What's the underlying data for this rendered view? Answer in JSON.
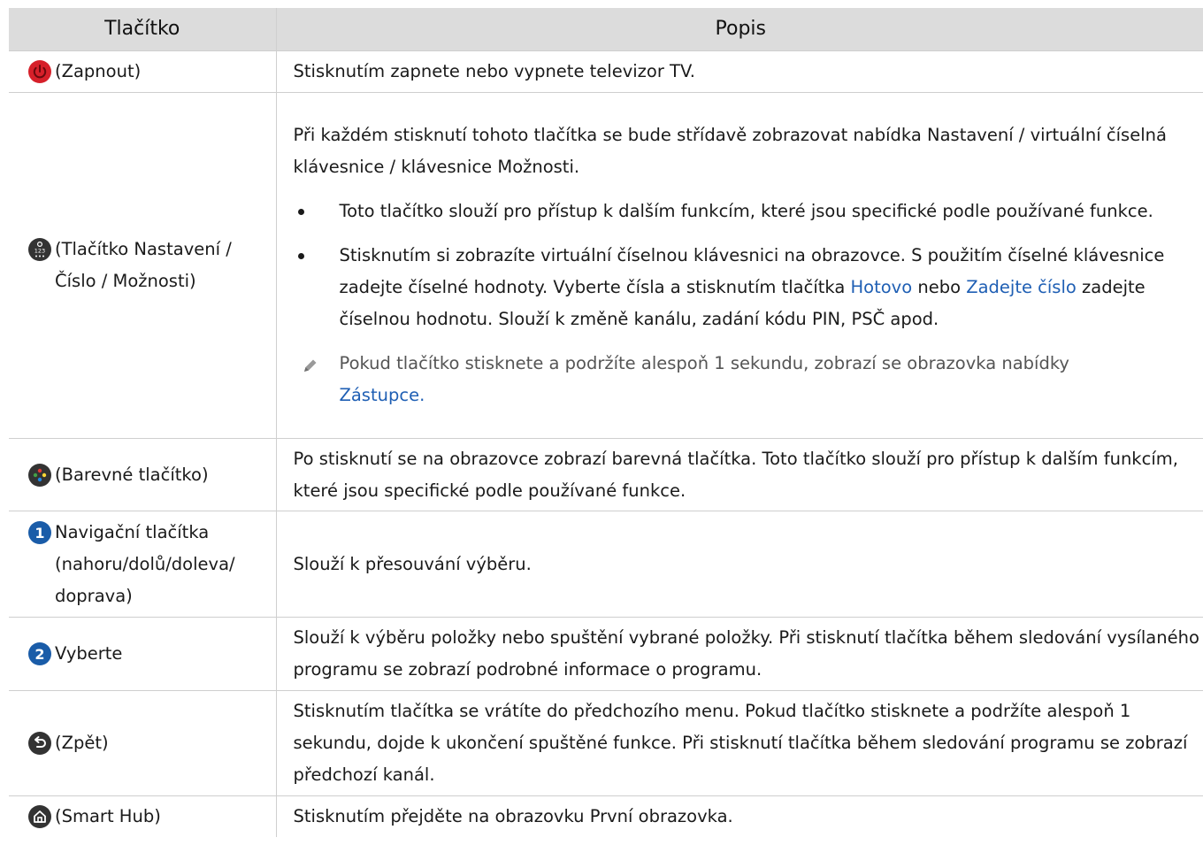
{
  "table": {
    "headers": [
      "Tlačítko",
      "Popis"
    ],
    "rows": {
      "power": {
        "button_label": "(Zapnout)",
        "icon": "power-icon",
        "desc": "Stisknutím zapnete nebo vypnete televizor TV."
      },
      "settings": {
        "button_label": "(Tlačítko Nastavení / Číslo / Možnosti)",
        "icon": "settings-number-icon",
        "desc_intro": "Při každém stisknutí tohoto tlačítka se bude střídavě zobrazovat nabídka Nastavení / virtuální číselná klávesnice / klávesnice Možnosti.",
        "bullet1": "Toto tlačítko slouží pro přístup k dalším funkcím, které jsou specifické podle používané funkce.",
        "bullet2_part1": "Stisknutím si zobrazíte virtuální číselnou klávesnici na obrazovce. S použitím číselné klávesnice zadejte číselné hodnoty. Vyberte čísla a stisknutím tlačítka",
        "bullet2_link1": "Hotovo",
        "bullet2_mid": "nebo",
        "bullet2_link2": "Zadejte číslo",
        "bullet2_part2": "zadejte číselnou hodnotu. Slouží k změně kanálu, zadání kódu PIN, PSČ apod.",
        "note_text": "Pokud tlačítko stisknete a podržíte alespoň 1 sekundu, zobrazí se obrazovka nabídky",
        "note_link": "Zástupce",
        "note_end": "."
      },
      "color": {
        "button_label": "(Barevné tlačítko)",
        "icon": "color-button-icon",
        "desc": "Po stisknutí se na obrazovce zobrazí barevná tlačítka. Toto tlačítko slouží pro přístup k dalším funkcím, které jsou specifické podle používané funkce."
      },
      "nav": {
        "badge": "1",
        "button_label": "Navigační tlačítka (nahoru/dolů/doleva/ doprava)",
        "desc": "Slouží k přesouvání výběru."
      },
      "select": {
        "badge": "2",
        "button_label": "Vyberte",
        "desc": "Slouží k výběru položky nebo spuštění vybrané položky. Při stisknutí tlačítka během sledování vysílaného programu se zobrazí podrobné informace o programu."
      },
      "back": {
        "button_label": "(Zpět)",
        "icon": "back-icon",
        "desc": "Stisknutím tlačítka se vrátíte do předchozího menu. Pokud tlačítko stisknete a podržíte alespoň 1 sekundu, dojde k ukončení spuštěné funkce. Při stisknutí tlačítka během sledování programu se zobrazí předchozí kanál."
      },
      "smarthub": {
        "button_label": "(Smart Hub)",
        "icon": "home-icon",
        "desc": "Stisknutím přejděte na obrazovku První obrazovka."
      }
    }
  },
  "colors": {
    "header_bg": "#dcdcdc",
    "link": "#1f5fb4",
    "power_red": "#d6202a",
    "badge_blue": "#1a5ca8",
    "icon_dark": "#333333"
  }
}
